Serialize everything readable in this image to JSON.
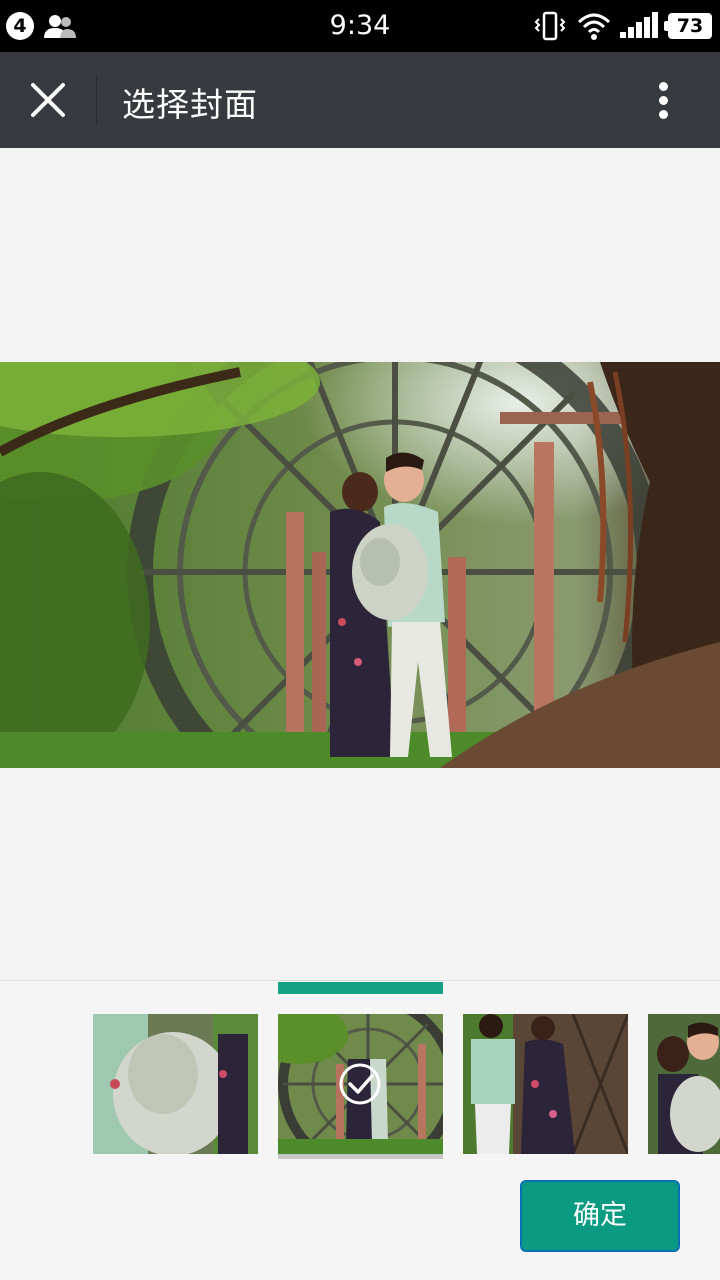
{
  "status_bar": {
    "notification_count": "4",
    "time": "9:34",
    "battery": "73"
  },
  "app_bar": {
    "title": "选择封面",
    "icons": [
      "close-icon",
      "more-vertical-icon"
    ]
  },
  "preview": {
    "description_icon": "cover-preview-photo"
  },
  "thumbnails": {
    "selected_index": 1,
    "count_visible": 4
  },
  "actions": {
    "confirm_label": "确定"
  },
  "colors": {
    "app_bar": "#373a3f",
    "accent": "#16a085",
    "confirm": "#0b9b82",
    "background": "#f3f3f3"
  }
}
